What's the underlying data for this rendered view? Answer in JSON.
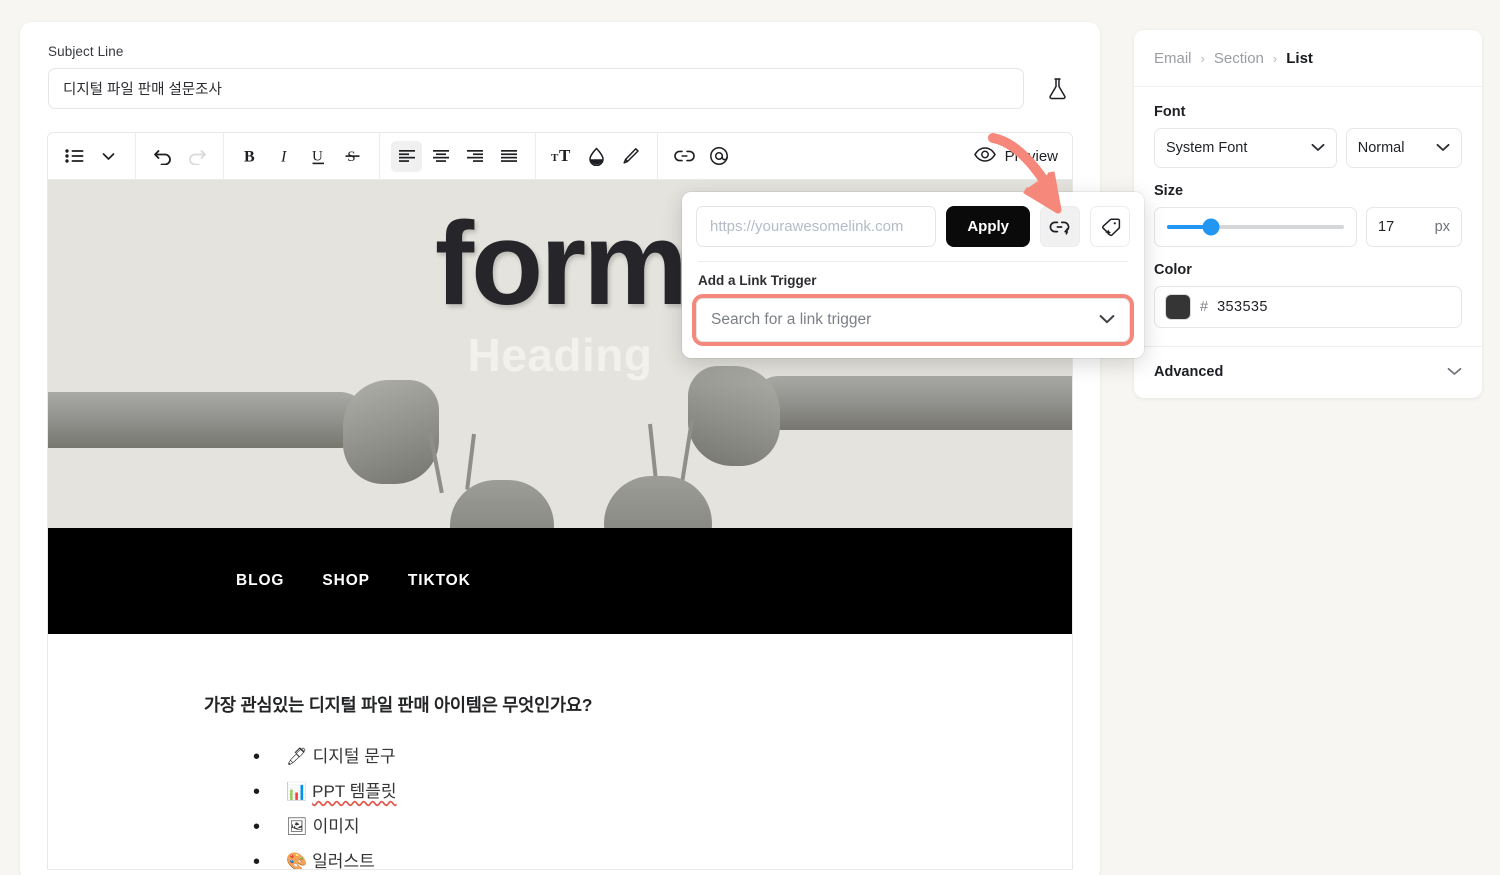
{
  "subject": {
    "label": "Subject Line",
    "value": "디지털 파일 판매 설문조사",
    "flask_icon": "flask-icon"
  },
  "toolbar": {
    "buttons": [
      {
        "name": "list-style-button",
        "icon": "bullet-list-icon"
      },
      {
        "name": "list-style-chevron",
        "icon": "chevron-down-icon"
      },
      {
        "name": "undo-button",
        "icon": "undo-arrow-icon"
      },
      {
        "name": "redo-button",
        "icon": "redo-arrow-icon"
      },
      {
        "name": "bold-button",
        "icon": "bold-B-icon"
      },
      {
        "name": "italic-button",
        "icon": "italic-I-icon"
      },
      {
        "name": "underline-button",
        "icon": "underline-U-icon"
      },
      {
        "name": "strikethrough-button",
        "icon": "strikethrough-S-icon"
      },
      {
        "name": "align-left-button",
        "icon": "align-left-icon"
      },
      {
        "name": "align-center-button",
        "icon": "align-center-icon"
      },
      {
        "name": "align-right-button",
        "icon": "align-right-icon"
      },
      {
        "name": "align-justify-button",
        "icon": "align-justify-icon"
      },
      {
        "name": "font-size-button",
        "icon": "text-size-icon"
      },
      {
        "name": "text-color-button",
        "icon": "droplet-icon"
      },
      {
        "name": "highlight-button",
        "icon": "marker-pen-icon"
      },
      {
        "name": "insert-link-button",
        "icon": "link-icon"
      },
      {
        "name": "mention-button",
        "icon": "at-sign-icon"
      }
    ],
    "preview_label": "Preview",
    "preview_icon": "eye-icon"
  },
  "link_popover": {
    "url_placeholder": "https://yourawesomelink.com",
    "url_value": "",
    "apply_label": "Apply",
    "link_trigger_icon": "link-sparkle-icon",
    "tag_icon": "tag-sparkle-icon",
    "trigger_section_label": "Add a Link Trigger",
    "trigger_placeholder": "Search for a link trigger",
    "trigger_chevron": "chevron-down-icon",
    "highlight_color": "#f5887c"
  },
  "annotation": {
    "arrow_color": "#f5877b",
    "name": "red-arrow-annotation"
  },
  "email_preview": {
    "hero": {
      "logo_text": "form",
      "heading_overlay": "Heading",
      "bg_color": "#e4e3dd"
    },
    "nav": {
      "items": [
        "BLOG",
        "SHOP",
        "TIKTOK"
      ],
      "bg_color": "#000000"
    },
    "question": "가장 관심있는 디지털 파일 판매 아이템은 무엇인가요?",
    "options": [
      {
        "emoji": "🖊",
        "text": "디지털 문구",
        "misspelled": false
      },
      {
        "emoji": "📊",
        "text": "PPT 템플릿",
        "misspelled": true
      },
      {
        "emoji": "🖼",
        "text": "이미지",
        "misspelled": false
      },
      {
        "emoji": "🎨",
        "text": "일러스트",
        "misspelled": false
      }
    ]
  },
  "right_panel": {
    "breadcrumb": [
      {
        "label": "Email",
        "current": false
      },
      {
        "label": "Section",
        "current": false
      },
      {
        "label": "List",
        "current": true
      }
    ],
    "breadcrumb_sep": "›",
    "font": {
      "label": "Font",
      "family_value": "System Font",
      "weight_value": "Normal"
    },
    "size": {
      "label": "Size",
      "value": "17",
      "unit": "px",
      "percent": 25,
      "slider_color": "#2196f3"
    },
    "color": {
      "label": "Color",
      "hash": "#",
      "value": "353535",
      "swatch": "#353535"
    },
    "advanced": {
      "label": "Advanced",
      "chevron": "chevron-down-icon"
    }
  }
}
